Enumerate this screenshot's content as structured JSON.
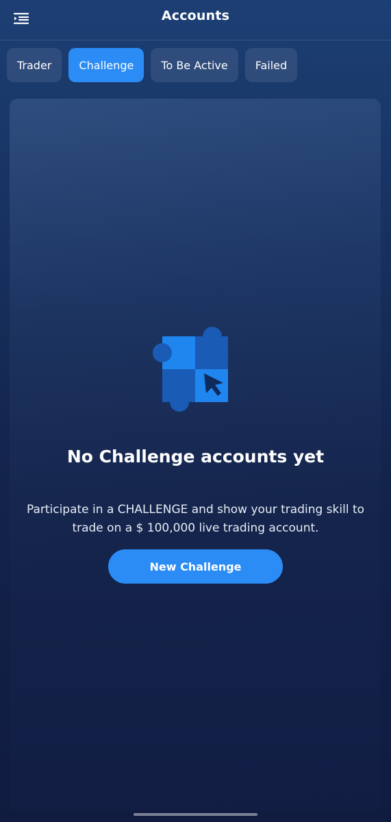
{
  "header": {
    "title": "Accounts",
    "menu_icon": "menu-collapse-icon"
  },
  "tabs": [
    {
      "label": "Trader",
      "active": false
    },
    {
      "label": "Challenge",
      "active": true
    },
    {
      "label": "To Be Active",
      "active": false
    },
    {
      "label": "Failed",
      "active": false
    }
  ],
  "empty_state": {
    "illustration_icon": "puzzle-cursor-icon",
    "title": "No Challenge accounts yet",
    "description": "Participate in a CHALLENGE and show your trading skill to trade on a $ 100,000 live trading account.",
    "button_label": "New Challenge"
  },
  "colors": {
    "accent": "#2b8cf5",
    "background_top": "#1c3f74",
    "background_bottom": "#101b40"
  }
}
